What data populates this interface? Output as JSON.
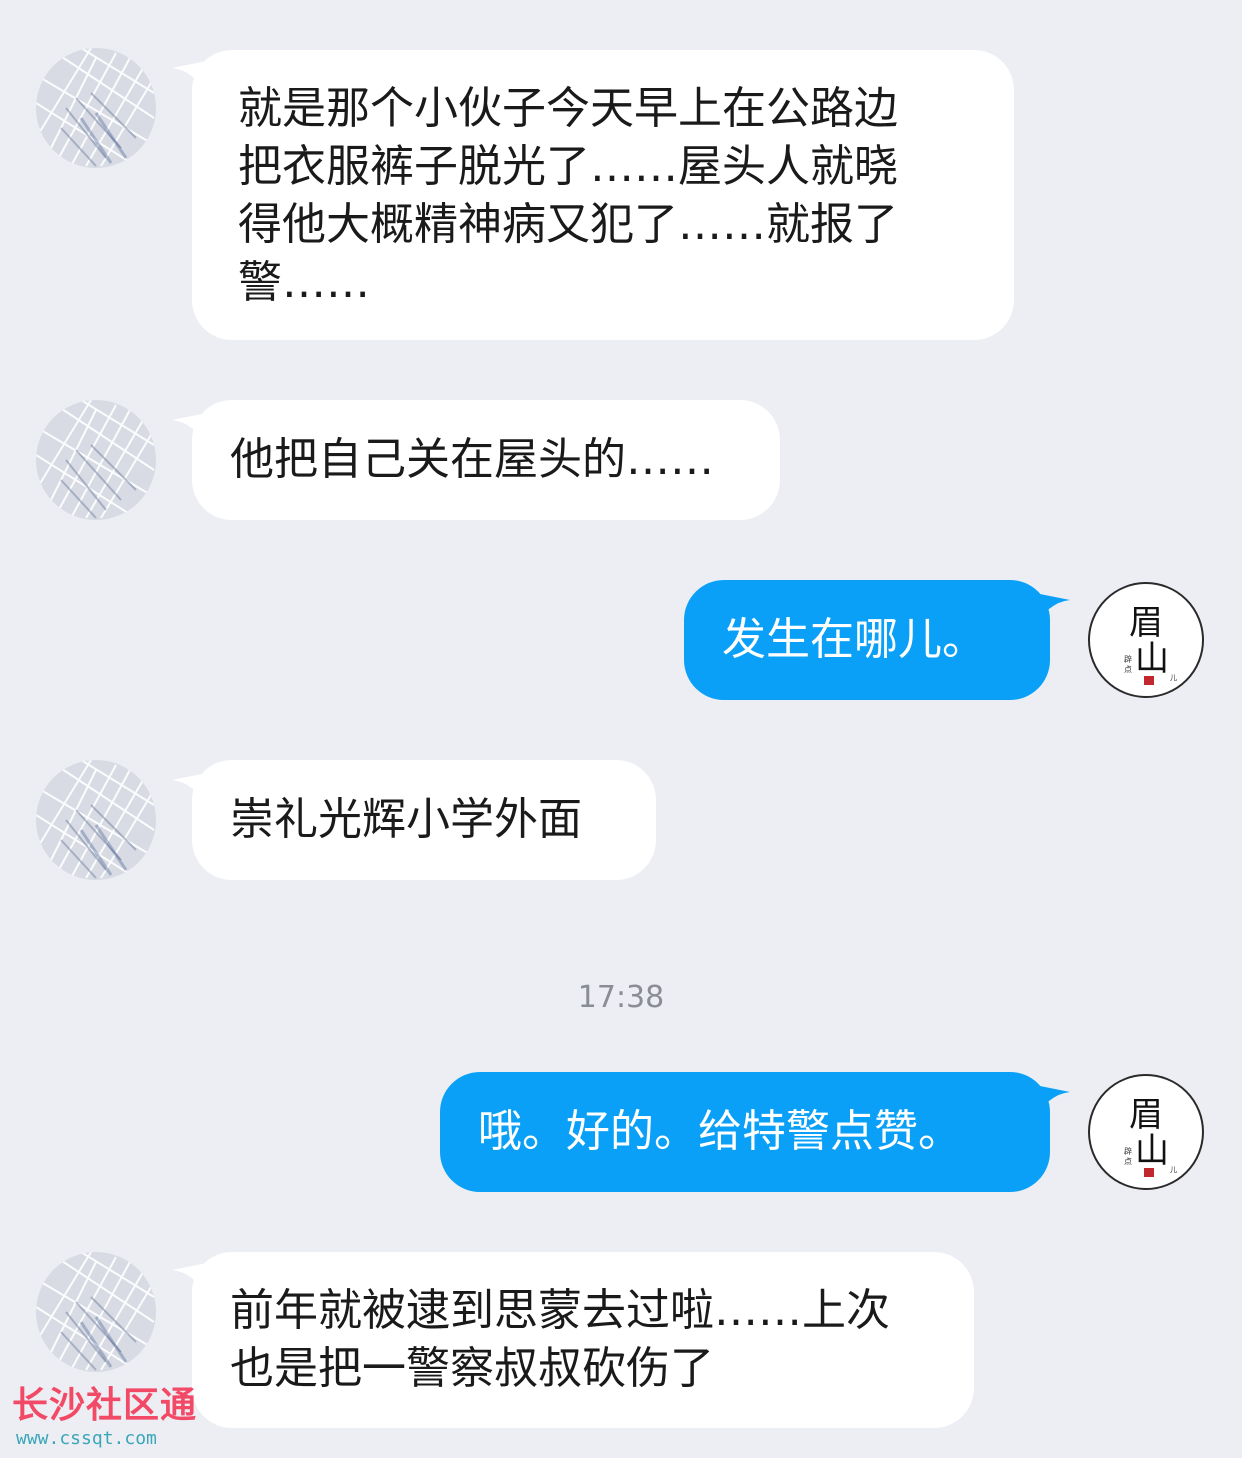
{
  "messages": [
    {
      "side": "in",
      "text": "就是那个小伙子今天早上在公路边把衣服裤子脱光了……屋头人就晓得他大概精神病又犯了……就报了警……",
      "lines": [
        "就是那个小伙子今天早上在公路边",
        "把衣服裤子脱光了……屋头人就晓",
        "得他大概精神病又犯了……就报了",
        "警……"
      ]
    },
    {
      "side": "in",
      "text": "他把自己关在屋头的……"
    },
    {
      "side": "out",
      "text": "发生在哪儿。"
    },
    {
      "side": "in",
      "text": "崇礼光辉小学外面"
    },
    {
      "side": "out",
      "text": "哦。好的。给特警点赞。"
    },
    {
      "side": "in",
      "text": "前年就被逮到思蒙去过啦……上次也是把一警察叔叔砍伤了",
      "lines": [
        "前年就被逮到思蒙去过啦……上次",
        "也是把一警察叔叔砍伤了"
      ]
    }
  ],
  "timestamp": "17:38",
  "self_avatar": {
    "big_text": "眉山",
    "small_text": "辟点事儿"
  },
  "watermark": {
    "title": "长沙社区通",
    "url": "www.cssqt.com"
  },
  "colors": {
    "background": "#eceef3",
    "incoming_bubble": "#ffffff",
    "outgoing_bubble": "#0aa0f8",
    "watermark": "#f24a66"
  }
}
